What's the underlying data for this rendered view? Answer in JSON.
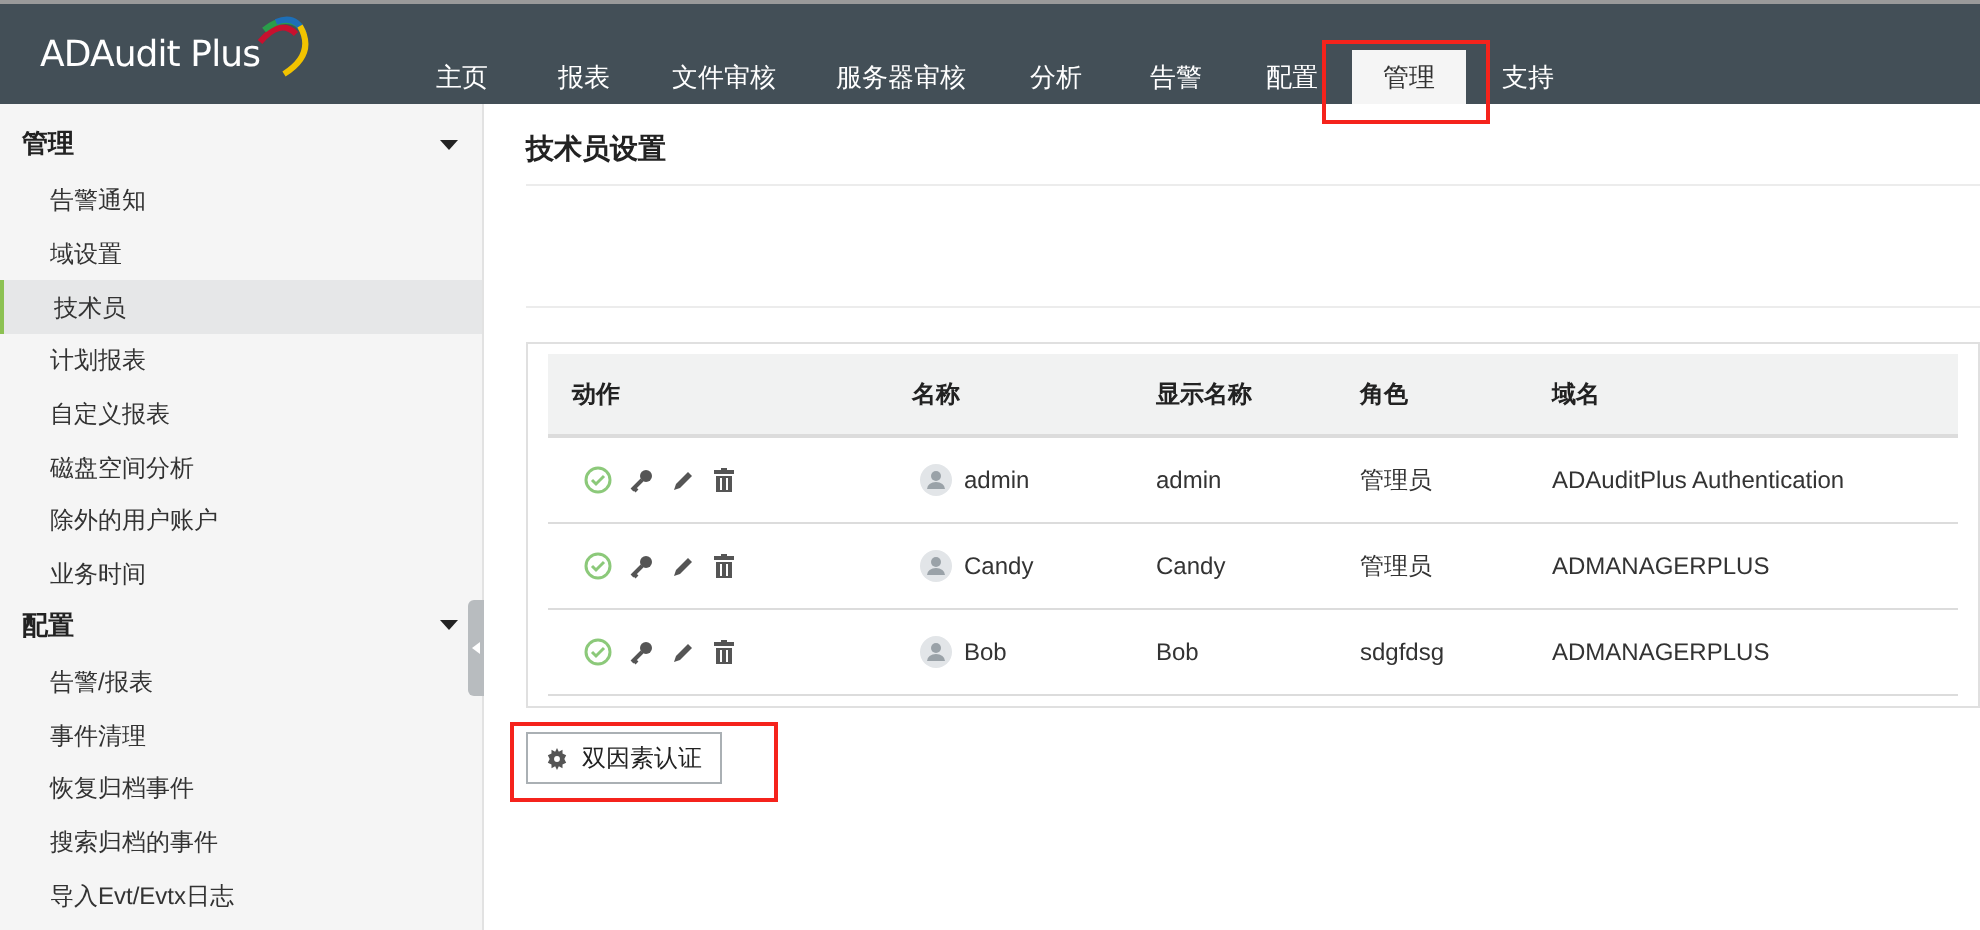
{
  "app": {
    "logo": "ADAudit Plus"
  },
  "nav_tabs": [
    {
      "label": "主页",
      "selected": false
    },
    {
      "label": "报表",
      "selected": false
    },
    {
      "label": "文件审核",
      "selected": false
    },
    {
      "label": "服务器审核",
      "selected": false
    },
    {
      "label": "分析",
      "selected": false
    },
    {
      "label": "告警",
      "selected": false
    },
    {
      "label": "配置",
      "selected": false
    },
    {
      "label": "管理",
      "selected": true
    },
    {
      "label": "支持",
      "selected": false
    }
  ],
  "sidebar": {
    "sections": [
      {
        "title": "管理",
        "expanded": true,
        "items": [
          {
            "label": "告警通知",
            "selected": false
          },
          {
            "label": "域设置",
            "selected": false
          },
          {
            "label": "技术员",
            "selected": true
          },
          {
            "label": "计划报表",
            "selected": false
          },
          {
            "label": "自定义报表",
            "selected": false
          },
          {
            "label": "磁盘空间分析",
            "selected": false
          },
          {
            "label": "除外的用户账户",
            "selected": false
          },
          {
            "label": "业务时间",
            "selected": false
          }
        ]
      },
      {
        "title": "配置",
        "expanded": true,
        "items": [
          {
            "label": "告警/报表",
            "selected": false
          },
          {
            "label": "事件清理",
            "selected": false
          },
          {
            "label": "恢复归档事件",
            "selected": false
          },
          {
            "label": "搜索归档的事件",
            "selected": false
          },
          {
            "label": "导入Evt/Evtx日志",
            "selected": false
          }
        ]
      }
    ]
  },
  "page": {
    "title": "技术员设置"
  },
  "table": {
    "columns": [
      "动作",
      "名称",
      "显示名称",
      "角色",
      "域名"
    ],
    "rows": [
      {
        "name": "admin",
        "display_name": "admin",
        "role": "管理员",
        "domain": "ADAuditPlus Authentication"
      },
      {
        "name": "Candy",
        "display_name": "Candy",
        "role": "管理员",
        "domain": "ADMANAGERPLUS"
      },
      {
        "name": "Bob",
        "display_name": "Bob",
        "role": "sdgfdsg",
        "domain": "ADMANAGERPLUS"
      }
    ]
  },
  "buttons": [
    {
      "label": "双因素认证"
    }
  ]
}
